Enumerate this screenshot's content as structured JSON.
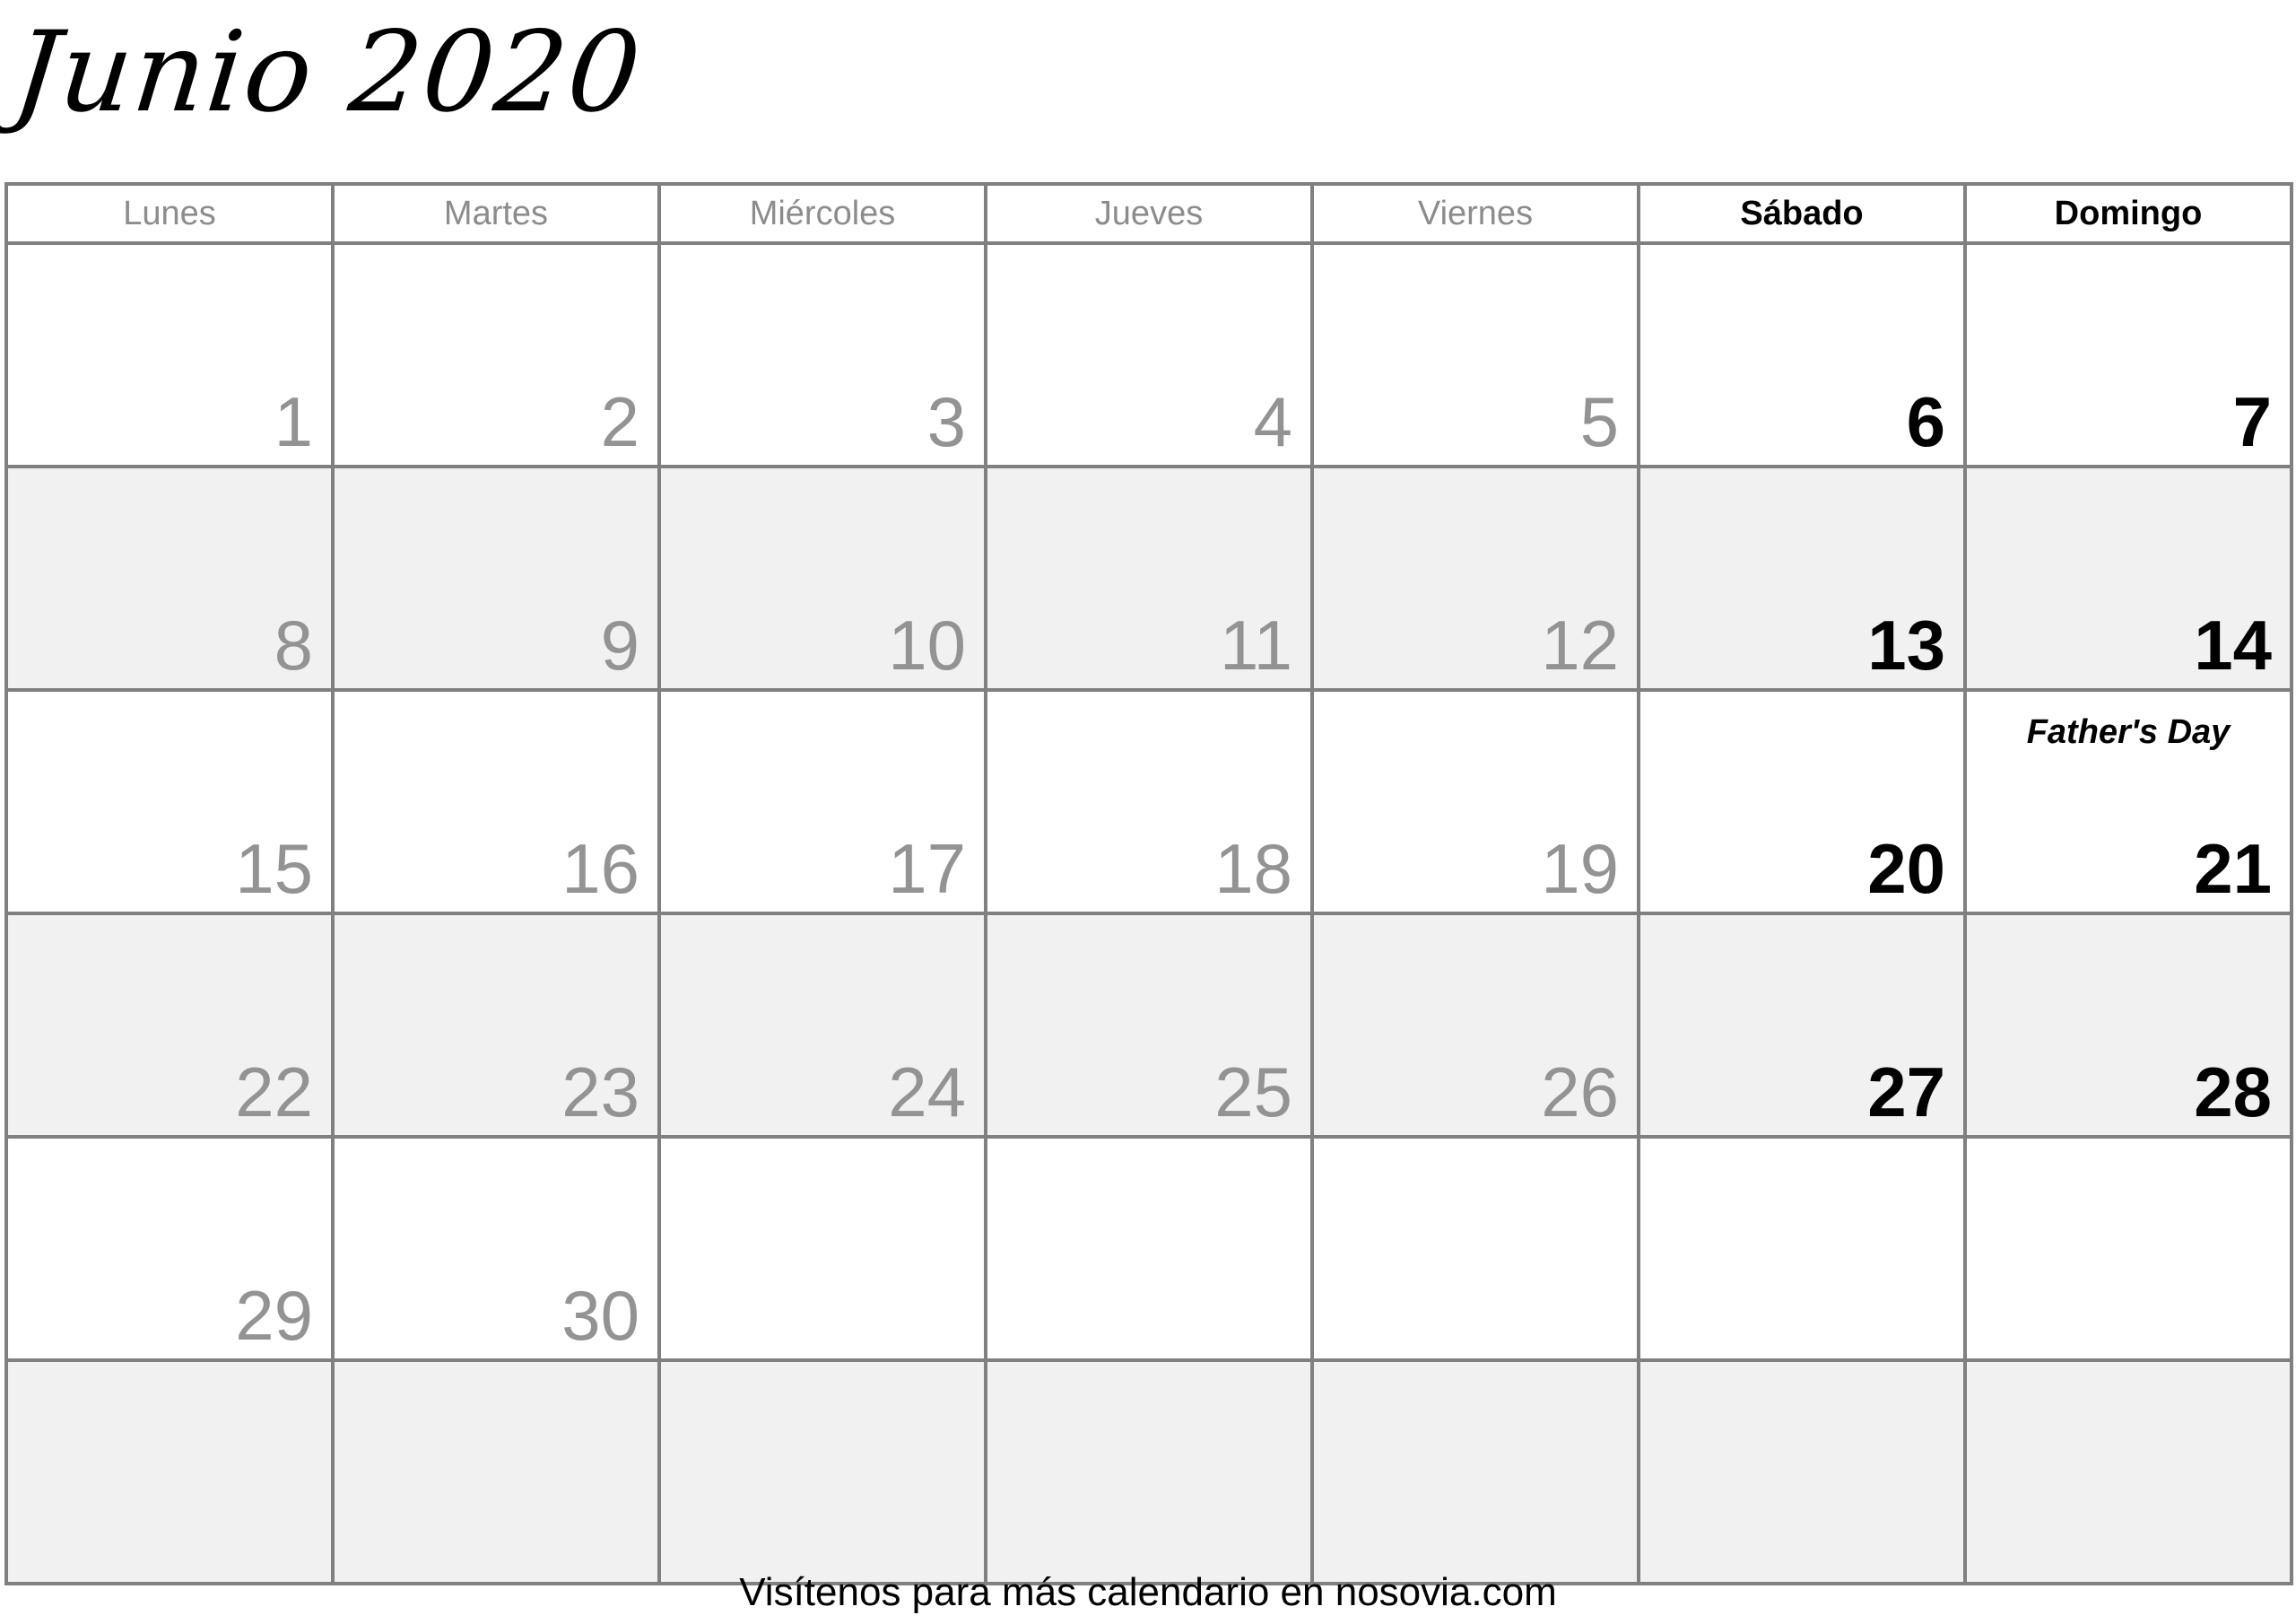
{
  "title": "Junio 2020",
  "month": "Junio",
  "year": "2020",
  "locale": "es",
  "colors": {
    "border": "#808080",
    "shaded_row_bg": "#f1f1f1",
    "plain_row_bg": "#ffffff",
    "weekday_text": "#939393",
    "weekend_text": "#000000",
    "header_weekday_text": "#8c8c8c"
  },
  "weekday_headers": [
    {
      "label": "Lunes",
      "weekend": false
    },
    {
      "label": "Martes",
      "weekend": false
    },
    {
      "label": "Miércoles",
      "weekend": false
    },
    {
      "label": "Jueves",
      "weekend": false
    },
    {
      "label": "Viernes",
      "weekend": false
    },
    {
      "label": "Sábado",
      "weekend": true
    },
    {
      "label": "Domingo",
      "weekend": true
    }
  ],
  "weeks": [
    {
      "shaded": false,
      "days": [
        {
          "num": "1",
          "weekend": false,
          "event": ""
        },
        {
          "num": "2",
          "weekend": false,
          "event": ""
        },
        {
          "num": "3",
          "weekend": false,
          "event": ""
        },
        {
          "num": "4",
          "weekend": false,
          "event": ""
        },
        {
          "num": "5",
          "weekend": false,
          "event": ""
        },
        {
          "num": "6",
          "weekend": true,
          "event": ""
        },
        {
          "num": "7",
          "weekend": true,
          "event": ""
        }
      ]
    },
    {
      "shaded": true,
      "days": [
        {
          "num": "8",
          "weekend": false,
          "event": ""
        },
        {
          "num": "9",
          "weekend": false,
          "event": ""
        },
        {
          "num": "10",
          "weekend": false,
          "event": ""
        },
        {
          "num": "11",
          "weekend": false,
          "event": ""
        },
        {
          "num": "12",
          "weekend": false,
          "event": ""
        },
        {
          "num": "13",
          "weekend": true,
          "event": ""
        },
        {
          "num": "14",
          "weekend": true,
          "event": ""
        }
      ]
    },
    {
      "shaded": false,
      "days": [
        {
          "num": "15",
          "weekend": false,
          "event": ""
        },
        {
          "num": "16",
          "weekend": false,
          "event": ""
        },
        {
          "num": "17",
          "weekend": false,
          "event": ""
        },
        {
          "num": "18",
          "weekend": false,
          "event": ""
        },
        {
          "num": "19",
          "weekend": false,
          "event": ""
        },
        {
          "num": "20",
          "weekend": true,
          "event": ""
        },
        {
          "num": "21",
          "weekend": true,
          "event": "Father's Day"
        }
      ]
    },
    {
      "shaded": true,
      "days": [
        {
          "num": "22",
          "weekend": false,
          "event": ""
        },
        {
          "num": "23",
          "weekend": false,
          "event": ""
        },
        {
          "num": "24",
          "weekend": false,
          "event": ""
        },
        {
          "num": "25",
          "weekend": false,
          "event": ""
        },
        {
          "num": "26",
          "weekend": false,
          "event": ""
        },
        {
          "num": "27",
          "weekend": true,
          "event": ""
        },
        {
          "num": "28",
          "weekend": true,
          "event": ""
        }
      ]
    },
    {
      "shaded": false,
      "days": [
        {
          "num": "29",
          "weekend": false,
          "event": ""
        },
        {
          "num": "30",
          "weekend": false,
          "event": ""
        },
        {
          "num": "",
          "weekend": false,
          "event": ""
        },
        {
          "num": "",
          "weekend": false,
          "event": ""
        },
        {
          "num": "",
          "weekend": false,
          "event": ""
        },
        {
          "num": "",
          "weekend": true,
          "event": ""
        },
        {
          "num": "",
          "weekend": true,
          "event": ""
        }
      ]
    },
    {
      "shaded": true,
      "days": [
        {
          "num": "",
          "weekend": false,
          "event": ""
        },
        {
          "num": "",
          "weekend": false,
          "event": ""
        },
        {
          "num": "",
          "weekend": false,
          "event": ""
        },
        {
          "num": "",
          "weekend": false,
          "event": ""
        },
        {
          "num": "",
          "weekend": false,
          "event": ""
        },
        {
          "num": "",
          "weekend": true,
          "event": ""
        },
        {
          "num": "",
          "weekend": true,
          "event": ""
        }
      ]
    }
  ],
  "footer": {
    "text": "Visítenos para más calendario en nosovia.com"
  }
}
